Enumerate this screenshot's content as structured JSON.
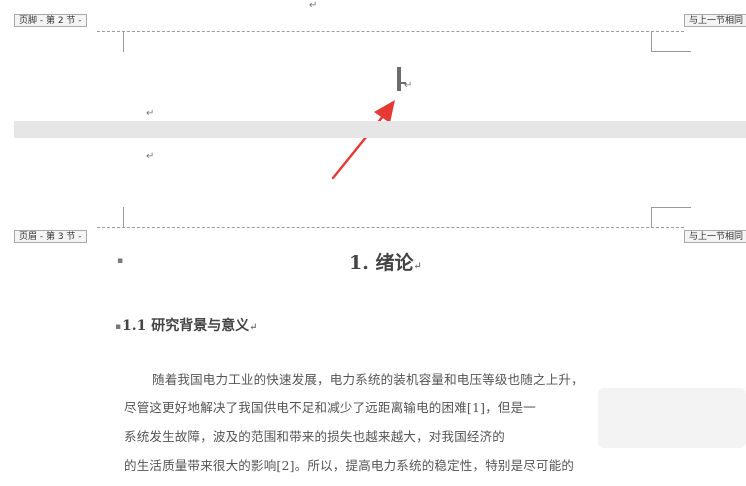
{
  "top_mark": "↵",
  "footer_sec2": {
    "tag": "页脚 - 第 2 节 -",
    "link": "与上一节相同"
  },
  "header_sec3": {
    "tag": "页眉 - 第 3 节 -",
    "link": "与上一节相同"
  },
  "marks": {
    "cursor_para": "↵",
    "footer_para_1": "↵",
    "header_para_1": "↵"
  },
  "heading1": {
    "bullet": "▪",
    "text": "1.  绪论",
    "mark": "↵"
  },
  "heading2": {
    "bullet": "▪",
    "text": "1.1 研究背景与意义",
    "mark": "↵"
  },
  "body": [
    "随着我国电力工业的快速发展，电力系统的装机容量和电压等级也随之上升，",
    "尽管这更好地解决了我国供电不足和减少了远距离输电的困难[1]，但是一",
    "系统发生故障，波及的范围和带来的损失也越来越大，对我国经济的",
    "的生活质量带来很大的影响[2]。所以，提高电力系统的稳定性，特别是尽可能的"
  ],
  "colors": {
    "arrow": "#e53935",
    "band": "#e6e6e6",
    "tag_border": "#a9a9a9"
  }
}
